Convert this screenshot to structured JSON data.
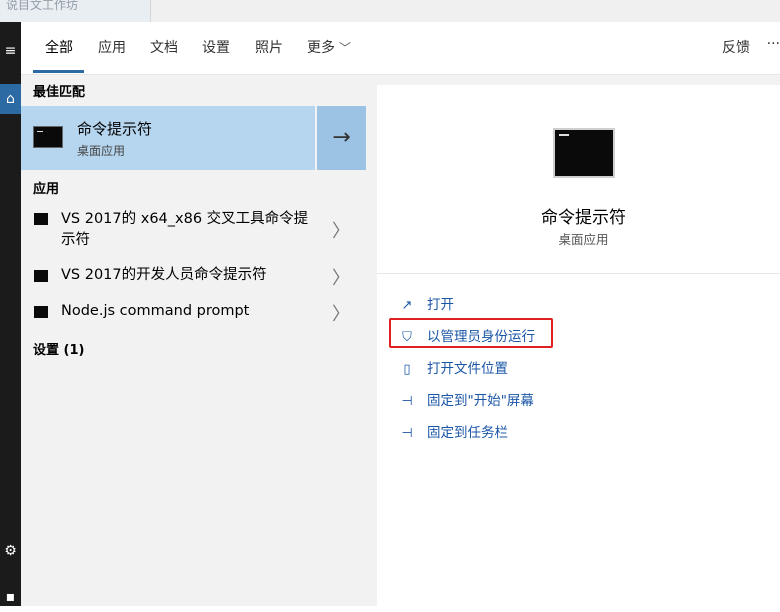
{
  "background": {
    "partial_tab_text": "说目文工作坊"
  },
  "rail": {
    "menu_icon": "hamburger-icon",
    "home_icon": "home-icon",
    "settings_icon": "gear-icon",
    "power_icon": "power-icon"
  },
  "tabs": {
    "items": [
      {
        "label": "全部"
      },
      {
        "label": "应用"
      },
      {
        "label": "文档"
      },
      {
        "label": "设置"
      },
      {
        "label": "照片"
      },
      {
        "label": "更多"
      }
    ],
    "feedback_label": "反馈",
    "ellipsis_label": "···"
  },
  "results": {
    "best_match_title": "最佳匹配",
    "best_match": {
      "name": "命令提示符",
      "type": "桌面应用",
      "arrow": "→"
    },
    "apps_title": "应用",
    "apps": [
      {
        "line1": "VS 2017的 x64_x86 交叉工具命令提",
        "line2": "示符"
      },
      {
        "line1": "VS 2017的开发人员命令提示符"
      },
      {
        "line1": "Node.js command prompt"
      }
    ],
    "settings_title": "设置 (1)"
  },
  "details": {
    "title": "命令提示符",
    "subtitle": "桌面应用",
    "actions": [
      {
        "label": "打开",
        "icon": "open-icon"
      },
      {
        "label": "以管理员身份运行",
        "icon": "shield-icon"
      },
      {
        "label": "打开文件位置",
        "icon": "folder-icon"
      },
      {
        "label": "固定到\"开始\"屏幕",
        "icon": "pin-icon"
      },
      {
        "label": "固定到任务栏",
        "icon": "pin-icon"
      }
    ]
  },
  "colors": {
    "accent": "#2b6aa3",
    "selection": "#b6d6f0",
    "link": "#1a56a6",
    "highlight": "#e02020"
  }
}
